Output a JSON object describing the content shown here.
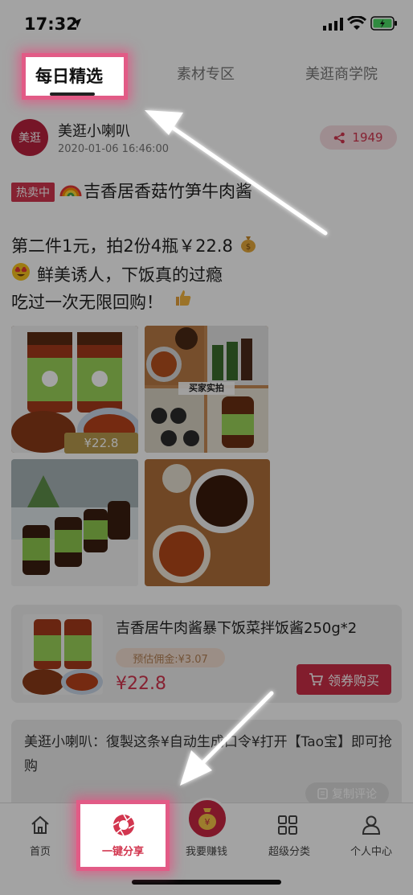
{
  "status_bar": {
    "time": "17:32"
  },
  "tabs": [
    {
      "label": "每日精选"
    },
    {
      "label": "素材专区"
    },
    {
      "label": "美逛商学院"
    }
  ],
  "post": {
    "avatar_text": "美逛",
    "author": "美逛小喇叭",
    "timestamp": "2020-01-06 16:46:00",
    "share_count": "1949",
    "badge": "热卖中",
    "title": "吉香居香菇竹笋牛肉酱",
    "line1": "第二件1元，拍2份4瓶￥22.8",
    "line2": "鲜美诱人，下饭真的过瘾",
    "line3": "吃过一次无限回购！",
    "image_price_tag": "¥22.8",
    "image_caption": "买家实拍"
  },
  "product": {
    "title": "吉香居牛肉酱暴下饭菜拌饭酱250g*2",
    "commission": "预估佣金:¥3.07",
    "price": "¥22.8",
    "coupon_button": "领券购买"
  },
  "comment": {
    "text": "美逛小喇叭：復製这条¥自动生成口令¥打开【Tao宝】即可抢购",
    "copy_button": "复制评论"
  },
  "bottom_nav": [
    {
      "label": "首页",
      "icon": "home-icon"
    },
    {
      "label": "一键分享",
      "icon": "share-camera-icon"
    },
    {
      "label": "我要赚钱",
      "icon": "money-bag-icon"
    },
    {
      "label": "超级分类",
      "icon": "grid-icon"
    },
    {
      "label": "个人中心",
      "icon": "person-icon"
    }
  ],
  "colors": {
    "accent": "#d2364f",
    "highlight": "#e25b86",
    "avatar": "#b9213e"
  }
}
